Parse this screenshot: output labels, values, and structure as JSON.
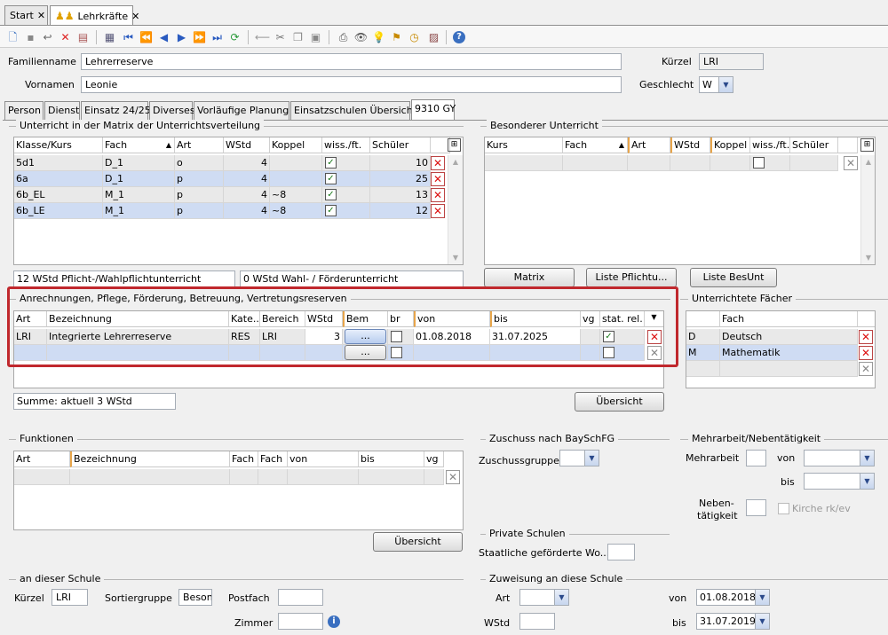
{
  "doc_tabs": [
    {
      "label": "Start"
    },
    {
      "label": "Lehrkräfte"
    }
  ],
  "close_glyph": "✕",
  "form": {
    "familienname_label": "Familienname",
    "familienname": "Lehrerreserve",
    "vornamen_label": "Vornamen",
    "vornamen": "Leonie",
    "kuerzel_label": "Kürzel",
    "kuerzel": "LRI",
    "geschlecht_label": "Geschlecht",
    "geschlecht": "W"
  },
  "page_tabs": [
    "Person",
    "Dienst",
    "Einsatz 24/25",
    "Diverses",
    "Vorläufige Planung",
    "Einsatzschulen Übersicht",
    "9310 GY"
  ],
  "matrix": {
    "title": "Unterricht in der Matrix der Unterrichtsverteilung",
    "headers": [
      "Klasse/Kurs",
      "Fach",
      "Art",
      "WStd",
      "Koppel",
      "wiss./ft.",
      "Schüler"
    ],
    "rows": [
      {
        "klasse": "5d1",
        "fach": "D_1",
        "art": "o",
        "wstd": "4",
        "koppel": "",
        "schueler": "10"
      },
      {
        "klasse": "6a",
        "fach": "D_1",
        "art": "p",
        "wstd": "4",
        "koppel": "",
        "schueler": "25"
      },
      {
        "klasse": "6b_EL",
        "fach": "M_1",
        "art": "p",
        "wstd": "4",
        "koppel": "~8",
        "schueler": "13"
      },
      {
        "klasse": "6b_LE",
        "fach": "M_1",
        "art": "p",
        "wstd": "4",
        "koppel": "~8",
        "schueler": "12"
      }
    ],
    "summary_left": "12 WStd Pflicht-/Wahlpflichtunterricht",
    "summary_right": "0 WStd Wahl- / Förderunterricht"
  },
  "besonderer": {
    "title": "Besonderer Unterricht",
    "headers": [
      "Kurs",
      "Fach",
      "Art",
      "WStd",
      "Koppel",
      "wiss./ft.",
      "Schüler"
    ]
  },
  "buttons": {
    "matrix": "Matrix",
    "pflicht": "Liste Pflichtu...",
    "besunt": "Liste BesUnt",
    "uebersicht": "Übersicht",
    "ellipsis": "..."
  },
  "anrechnungen": {
    "title": "Anrechnungen, Pflege, Förderung, Betreuung, Vertretungsreserven",
    "headers": [
      "Art",
      "Bezeichnung",
      "Kate...",
      "Bereich",
      "WStd",
      "Bem",
      "br",
      "von",
      "bis",
      "vg",
      "stat. rel."
    ],
    "row": {
      "art": "LRI",
      "bezeichnung": "Integrierte Lehrerreserve",
      "kategorie": "RES",
      "bereich": "LRI",
      "wstd": "3",
      "von": "01.08.2018",
      "bis": "31.07.2025"
    },
    "summe": "Summe: aktuell 3 WStd"
  },
  "faecher": {
    "title": "Unterrichtete Fächer",
    "header": "Fach",
    "rows": [
      {
        "code": "D",
        "name": "Deutsch"
      },
      {
        "code": "M",
        "name": "Mathematik"
      }
    ]
  },
  "funktionen": {
    "title": "Funktionen",
    "headers": [
      "Art",
      "Bezeichnung",
      "Fach",
      "Fach",
      "von",
      "bis",
      "vg"
    ]
  },
  "zuschuss": {
    "title": "Zuschuss nach BaySchFG",
    "label": "Zuschussgruppe"
  },
  "private": {
    "title": "Private Schulen",
    "label": "Staatliche geförderte Wo..."
  },
  "mehrarbeit": {
    "title": "Mehrarbeit/Nebentätigkeit",
    "mehrarbeit": "Mehrarbeit",
    "von": "von",
    "bis": "bis",
    "neben1": "Neben-",
    "neben2": "tätigkeit",
    "kirche": "Kirche rk/ev"
  },
  "schule": {
    "title": "an dieser Schule",
    "kuerzel_label": "Kürzel",
    "kuerzel": "LRI",
    "sort_label": "Sortiergruppe",
    "sort": "Beson",
    "postfach": "Postfach",
    "zimmer": "Zimmer"
  },
  "zuweisung": {
    "title": "Zuweisung an diese Schule",
    "art": "Art",
    "wstd": "WStd",
    "von": "von",
    "von_val": "01.08.2018",
    "bis": "bis",
    "bis_val": "31.07.2019"
  },
  "colors": {
    "highlight": "#c0282d",
    "selected": "#cfdcf3"
  }
}
